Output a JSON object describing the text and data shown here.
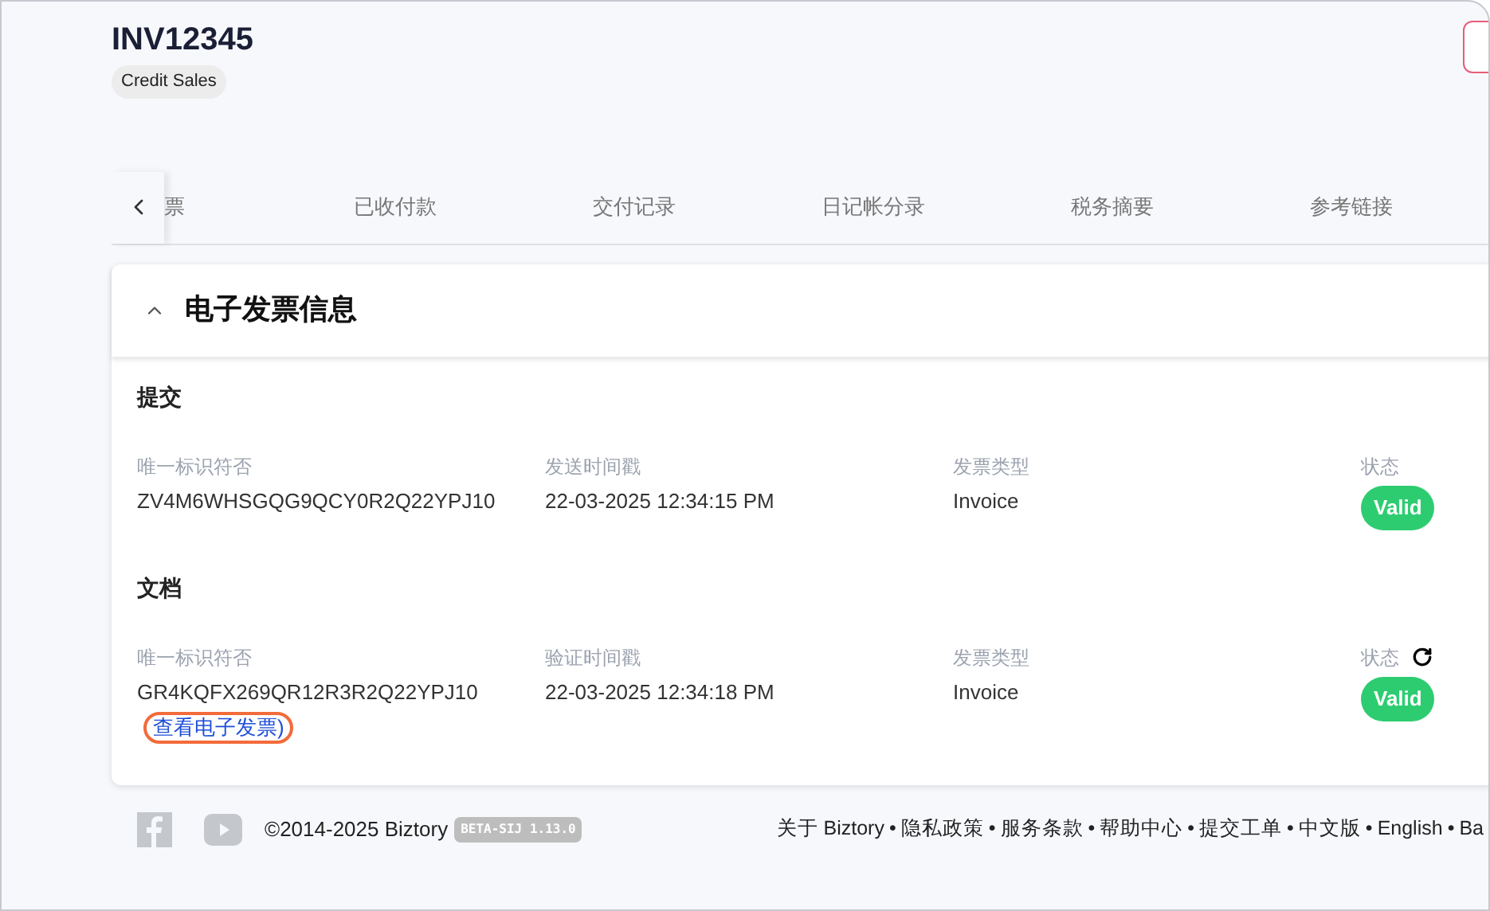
{
  "header": {
    "title": "INV12345",
    "badge": "Credit Sales"
  },
  "tabs": [
    {
      "label": "票",
      "selected": false
    },
    {
      "label": "已收付款",
      "selected": false
    },
    {
      "label": "交付记录",
      "selected": false
    },
    {
      "label": "日记帐分录",
      "selected": false
    },
    {
      "label": "税务摘要",
      "selected": false
    },
    {
      "label": "参考链接",
      "selected": false
    }
  ],
  "panel": {
    "title": "电子发票信息",
    "expanded": true,
    "sections": [
      {
        "title": "提交",
        "fields": [
          {
            "label": "唯一标识符否",
            "value": "ZV4M6WHSGQG9QCY0R2Q22YPJ10"
          },
          {
            "label": "发送时间戳",
            "value": "22-03-2025 12:34:15 PM"
          },
          {
            "label": "发票类型",
            "value": "Invoice"
          }
        ],
        "status_label": "状态",
        "status": "Valid",
        "refresh": false
      },
      {
        "title": "文档",
        "fields": [
          {
            "label": "唯一标识符否",
            "value": "GR4KQFX269QR12R3R2Q22YPJ10",
            "link": "查看电子发票)"
          },
          {
            "label": "验证时间戳",
            "value": "22-03-2025 12:34:18 PM"
          },
          {
            "label": "发票类型",
            "value": "Invoice"
          }
        ],
        "status_label": "状态",
        "status": "Valid",
        "refresh": true
      }
    ]
  },
  "footer": {
    "copyright": "©2014-2025 Biztory",
    "version": "BETA-SIJ 1.13.0",
    "links": [
      {
        "label": "关于 Biztory"
      },
      {
        "label": "隐私政策"
      },
      {
        "label": "服务条款"
      },
      {
        "label": "帮助中心"
      },
      {
        "label": "提交工单"
      },
      {
        "label": "中文版"
      },
      {
        "label": "English"
      },
      {
        "label": "Ba"
      }
    ],
    "separator": "•"
  }
}
